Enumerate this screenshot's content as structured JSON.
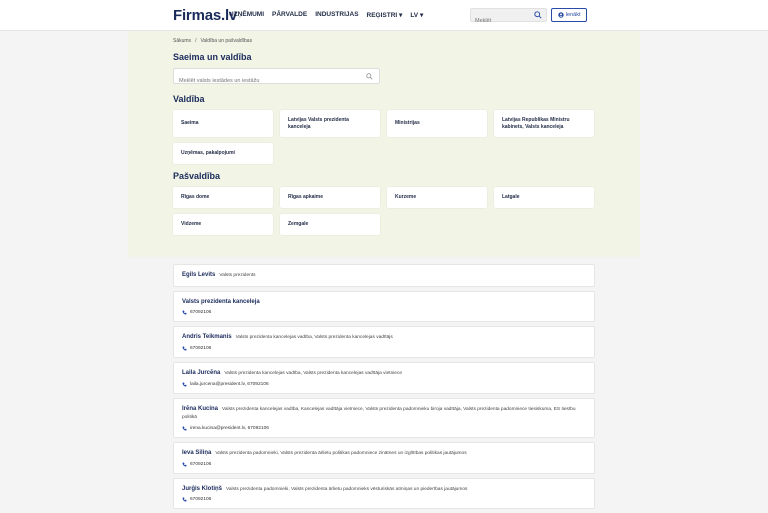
{
  "header": {
    "logo": "Firmas.lv",
    "nav": [
      "UZŅĒMUMI",
      "PĀRVALDE",
      "INDUSTRIJAS",
      "REĢISTRI ▾",
      "LV ▾"
    ],
    "search_placeholder": "Meklēt",
    "login_label": "Ienākt"
  },
  "breadcrumb": {
    "home": "Sākums",
    "sep": "/",
    "current": "Valdība un pašvaldības"
  },
  "page_title": "Saeima un valdība",
  "hero_search_placeholder": "Meklēt valsts iestādes un iestāžu",
  "sections": {
    "valdiba": {
      "title": "Valdība",
      "tiles": [
        "Saeima",
        "Latvijas Valsts prezidenta kanceleja",
        "Ministrijas",
        "Latvijas Republikas Ministru kabinets, Valsts kanceleja",
        "Uzņēmas, pakalpojumi"
      ]
    },
    "pasvaldiba": {
      "title": "Pašvaldība",
      "tiles": [
        "Rīgas dome",
        "Rīgas apkaime",
        "Kurzeme",
        "Latgale",
        "Vidzeme",
        "Zemgale"
      ]
    }
  },
  "people": [
    {
      "name": "Egils Levits",
      "role": "Valsts prezidents",
      "contact": ""
    },
    {
      "name": "Valsts prezidenta kanceleja",
      "role": "",
      "contact": "67092106"
    },
    {
      "name": "Andris Teikmanis",
      "role": "Valsts prezidenta kancelejas vadība, Valsts prezidenta kancelejas vadītājs",
      "contact": "67092106"
    },
    {
      "name": "Laila Jurcēna",
      "role": "Valsts prezidenta kancelejas vadība, Valsts prezidenta kancelejas vadītāja vietniece",
      "contact": "laila.jurcena@president.lv, 67092106"
    },
    {
      "name": "Irēna Kucina",
      "role": "Valsts prezidenta kancelejas vadība, Kancelejas vadītāja vietniece, Valsts prezidenta padomnieku biroja vadītāja, Valsts prezidenta padomniece tiesiskuma, ES tiesību politikā",
      "contact": "irena.kucina@president.lv, 67092106"
    },
    {
      "name": "Ieva Siliņa",
      "role": "Valsts prezidenta padomnieki, Valsts prezidenta ārlietu politikas padomniece zinātnes un izglītības politikas jautājumos",
      "contact": "67092106"
    },
    {
      "name": "Jurģis Klotiņš",
      "role": "Valsts prezidenta padomnieki, Valsts prezidenta ārlietu padomnieks vēsturiskās atmiņas un piederības jautājumos",
      "contact": "67092106"
    }
  ]
}
